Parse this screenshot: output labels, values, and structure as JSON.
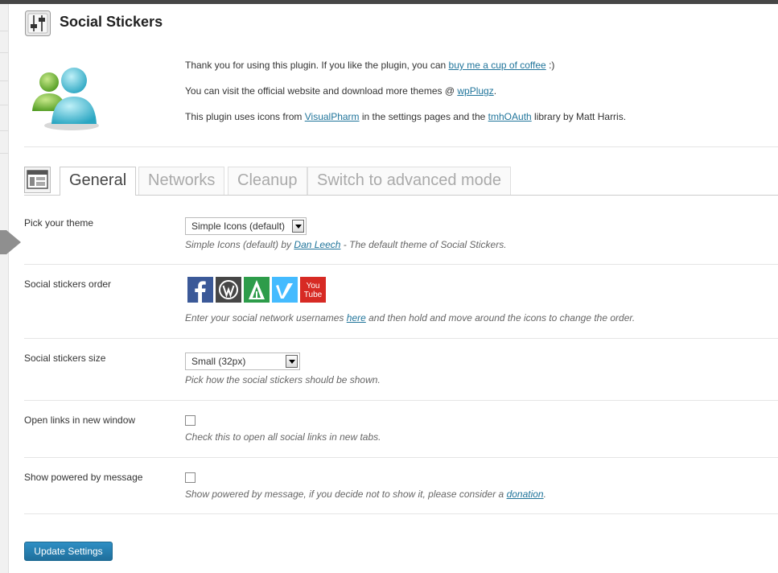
{
  "page": {
    "title": "Social Stickers"
  },
  "intro": {
    "line1_pre": "Thank you for using this plugin. If you like the plugin, you can ",
    "line1_link": "buy me a cup of coffee",
    "line1_post": " :)",
    "line2_pre": "You can visit the official website and download more themes @ ",
    "line2_link": "wpPlugz",
    "line2_post": ".",
    "line3_pre": "This plugin uses icons from ",
    "line3_link1": "VisualPharm",
    "line3_mid": " in the settings pages and the ",
    "line3_link2": "tmhOAuth",
    "line3_post": " library by Matt Harris."
  },
  "tabs": [
    {
      "label": "General",
      "active": true
    },
    {
      "label": "Networks",
      "active": false
    },
    {
      "label": "Cleanup",
      "active": false
    },
    {
      "label": "Switch to advanced mode",
      "active": false
    }
  ],
  "settings": {
    "theme": {
      "label": "Pick your theme",
      "value": "Simple Icons (default)",
      "desc_pre": "Simple Icons (default) by ",
      "desc_link": "Dan Leech",
      "desc_post": " - The default theme of Social Stickers."
    },
    "order": {
      "label": "Social stickers order",
      "stickers": [
        "facebook-icon",
        "wordpress-icon",
        "foursquare-icon",
        "vimeo-icon",
        "youtube-icon"
      ],
      "youtube_text": "You Tube",
      "desc_pre": "Enter your social network usernames ",
      "desc_link": "here",
      "desc_post": " and then hold and move around the icons to change the order."
    },
    "size": {
      "label": "Social stickers size",
      "value": "Small (32px)",
      "desc": "Pick how the social stickers should be shown."
    },
    "new_window": {
      "label": "Open links in new window",
      "checked": false,
      "desc": "Check this to open all social links in new tabs."
    },
    "powered_by": {
      "label": "Show powered by message",
      "checked": false,
      "desc_pre": "Show powered by message, if you decide not to show it, please consider a ",
      "desc_link": "donation",
      "desc_post": "."
    }
  },
  "update_button": "Update Settings",
  "colors": {
    "link": "#21759b",
    "button": "#21759b",
    "facebook": "#3b5998",
    "wordpress": "#464646",
    "foursquare": "#2d9c4a",
    "vimeo": "#44bbff",
    "youtube": "#d72a24"
  }
}
